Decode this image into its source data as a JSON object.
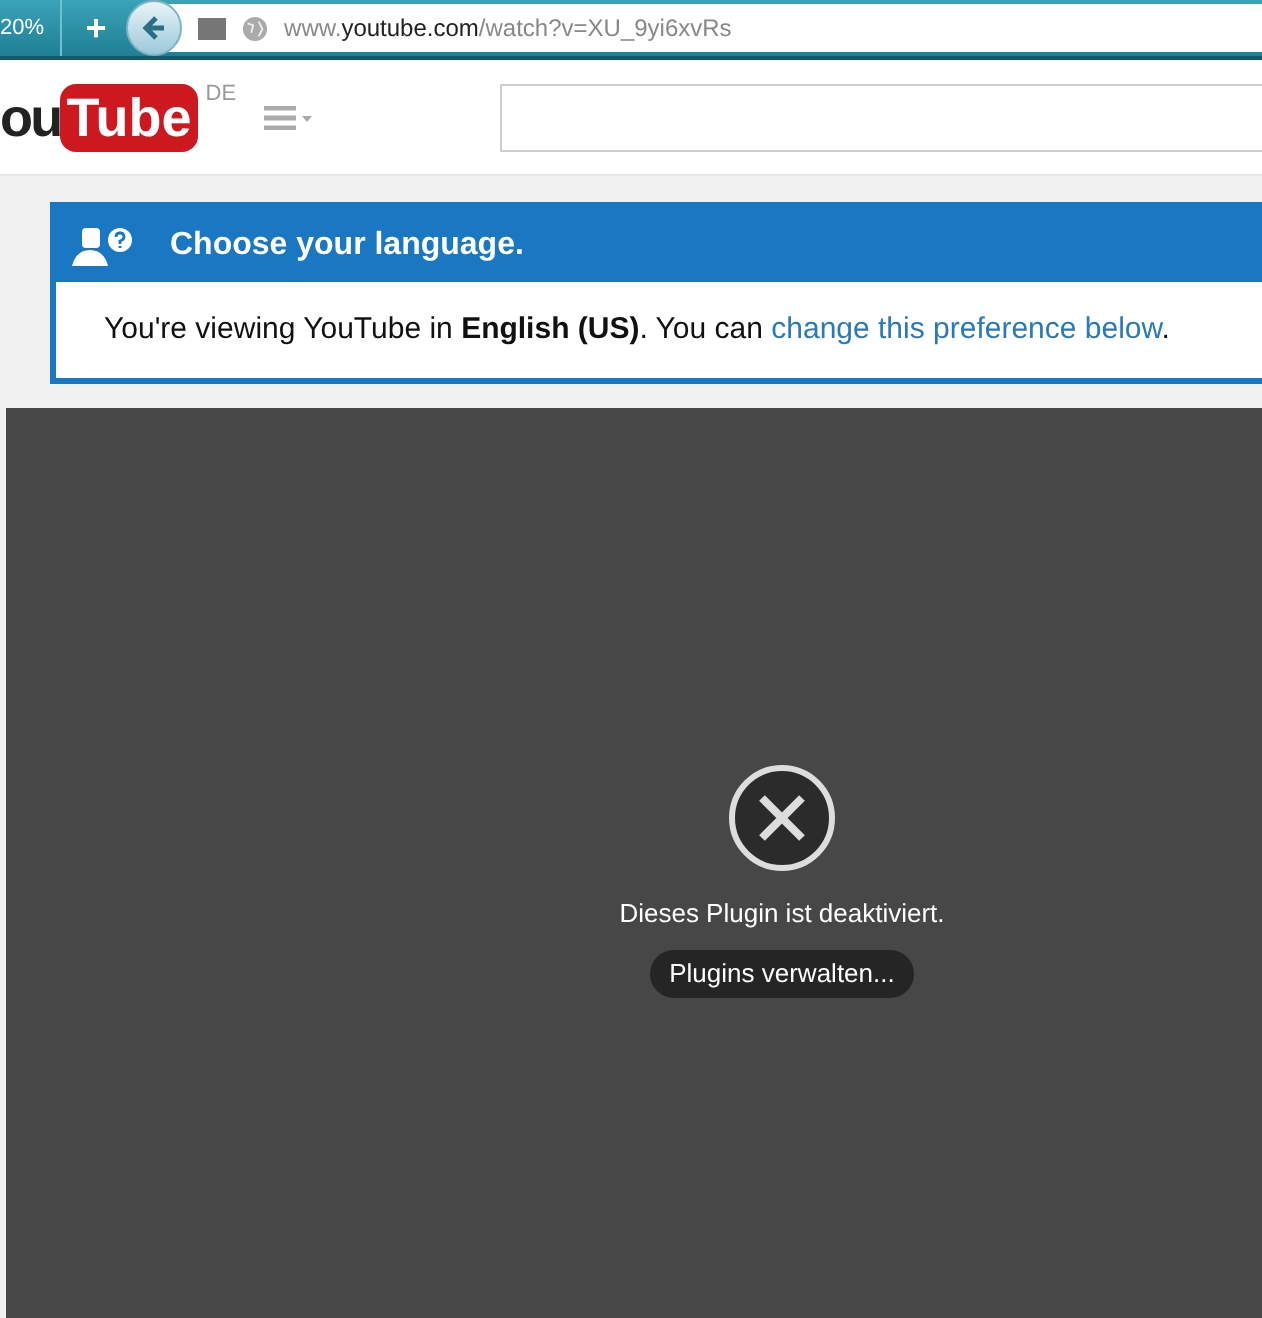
{
  "browser": {
    "zoom": "20%",
    "new_tab": "+",
    "url": {
      "prefix": "www.",
      "domain": "youtube.com",
      "path": "/watch?v=XU_9yi6xvRs"
    }
  },
  "header": {
    "logo": {
      "left": "ou",
      "box": "Tube"
    },
    "region": "DE"
  },
  "notice": {
    "title": "Choose your language.",
    "message": "You're viewing YouTube in **English (US)**. You can ",
    "link": "change this preference below",
    "end": "."
  },
  "player": {
    "message": "Dieses Plugin ist deaktiviert.",
    "button": "Plugins verwalten..."
  }
}
